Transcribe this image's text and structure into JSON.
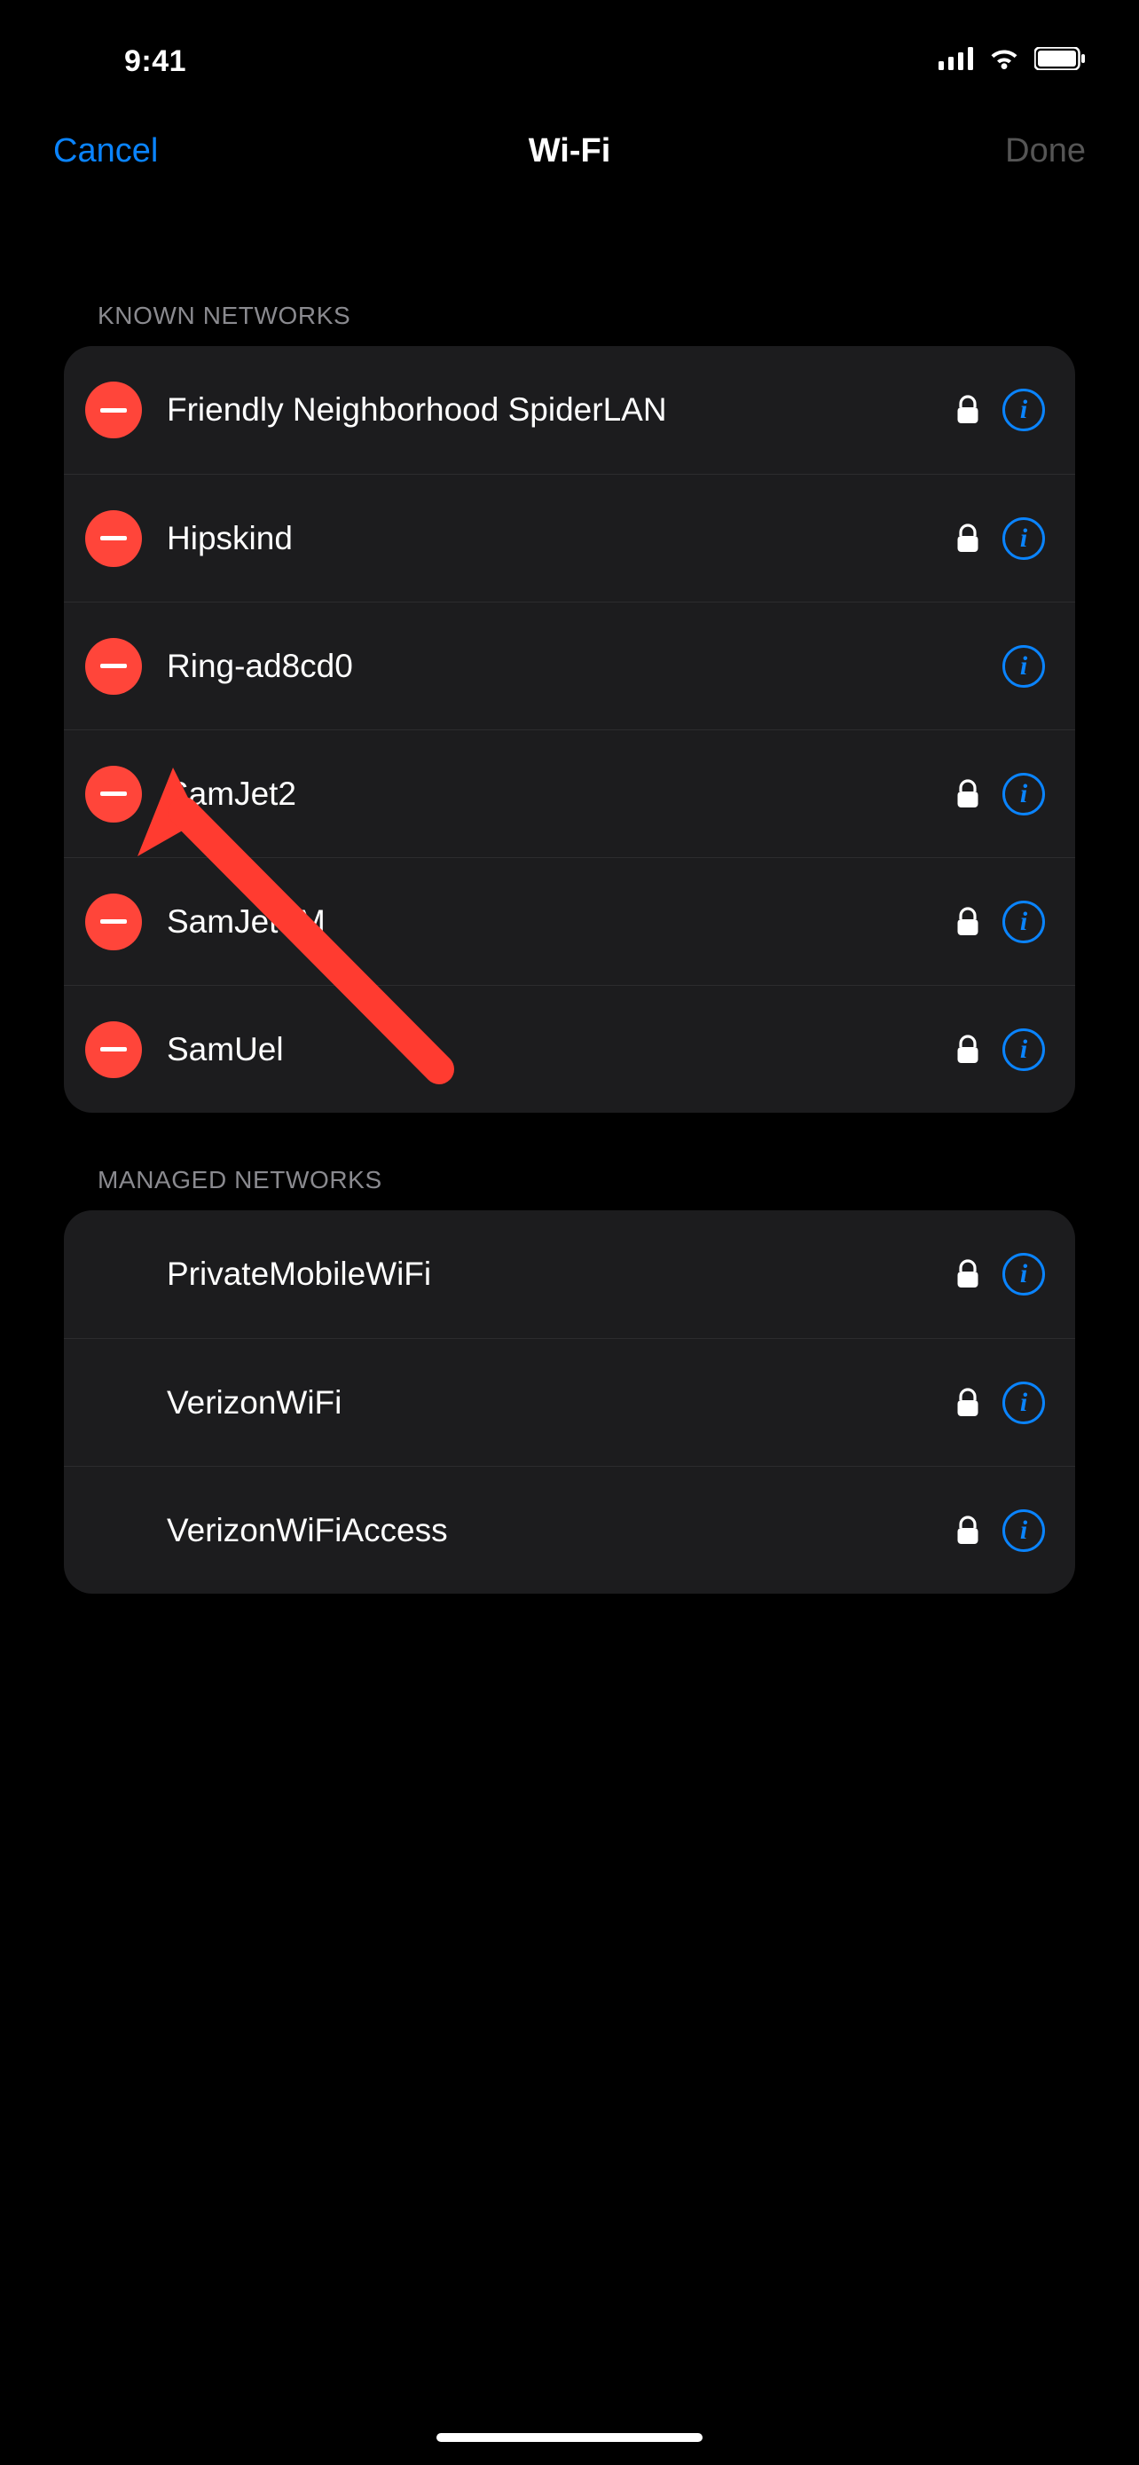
{
  "status": {
    "time": "9:41"
  },
  "nav": {
    "left": "Cancel",
    "title": "Wi-Fi",
    "right": "Done"
  },
  "sections": {
    "known": {
      "header": "Known Networks",
      "items": [
        {
          "name": "Friendly Neighborhood SpiderLAN",
          "locked": true
        },
        {
          "name": "Hipskind",
          "locked": true
        },
        {
          "name": "Ring-ad8cd0",
          "locked": false
        },
        {
          "name": "SamJet2",
          "locked": true
        },
        {
          "name": "SamJetTM",
          "locked": true
        },
        {
          "name": "SamUel",
          "locked": true
        }
      ]
    },
    "managed": {
      "header": "Managed Networks",
      "items": [
        {
          "name": "PrivateMobileWiFi",
          "locked": true
        },
        {
          "name": "VerizonWiFi",
          "locked": true
        },
        {
          "name": "VerizonWiFiAccess",
          "locked": true
        }
      ]
    }
  },
  "colors": {
    "accent": "#0a84ff",
    "destructive": "#ff453a",
    "bgGroup": "#1c1c1e"
  }
}
